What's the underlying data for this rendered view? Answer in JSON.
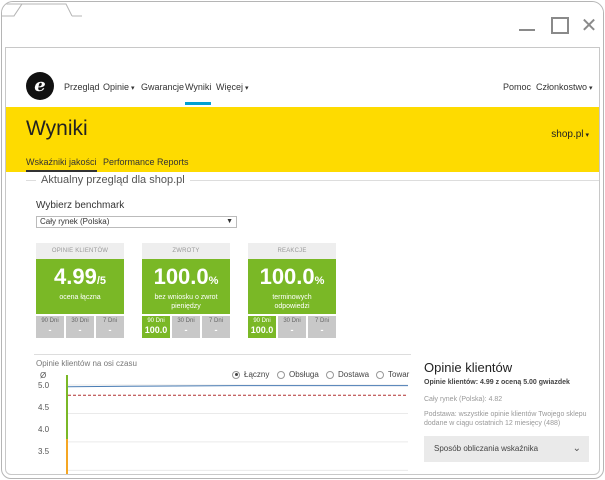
{
  "nav": {
    "items": [
      {
        "label": "Przegląd"
      },
      {
        "label": "Opinie"
      },
      {
        "label": "Gwarancje"
      },
      {
        "label": "Wyniki"
      },
      {
        "label": "Więcej"
      },
      {
        "label": "Pomoc"
      },
      {
        "label": "Członkostwo"
      }
    ]
  },
  "header": {
    "title": "Wyniki",
    "shop_selector": "shop.pl",
    "tabs": [
      {
        "label": "Wskaźniki jakości"
      },
      {
        "label": "Performance Reports"
      }
    ]
  },
  "overview": {
    "title": "Aktualny przegląd dla shop.pl",
    "benchmark_label": "Wybierz benchmark",
    "benchmark_value": "Cały rynek (Polska)"
  },
  "cards": [
    {
      "head": "OPINIE KLIENTÓW",
      "value": "4.99",
      "suffix": "/5",
      "sub": "ocena łączna",
      "periods": [
        {
          "label": "90 Dni",
          "value": "-"
        },
        {
          "label": "30 Dni",
          "value": "-"
        },
        {
          "label": "7 Dni",
          "value": "-"
        }
      ]
    },
    {
      "head": "ZWROTY",
      "value": "100.0",
      "suffix": "%",
      "sub": "bez wniosku o zwrot pieniędzy",
      "periods": [
        {
          "label": "90 Dni",
          "value": "100.0"
        },
        {
          "label": "30 Dni",
          "value": "-"
        },
        {
          "label": "7 Dni",
          "value": "-"
        }
      ]
    },
    {
      "head": "REAKCJE",
      "value": "100.0",
      "suffix": "%",
      "sub": "terminowych odpowiedzi",
      "periods": [
        {
          "label": "90 Dni",
          "value": "100.0"
        },
        {
          "label": "30 Dni",
          "value": "-"
        },
        {
          "label": "7 Dni",
          "value": "-"
        }
      ]
    }
  ],
  "chart": {
    "title": "Opinie klientów na osi czasu",
    "avg_label": "Ø",
    "legend": [
      {
        "label": "Łączny",
        "selected": true
      },
      {
        "label": "Obsługa",
        "selected": false
      },
      {
        "label": "Dostawa",
        "selected": false
      },
      {
        "label": "Towar",
        "selected": false
      }
    ],
    "yticks": [
      "5.0",
      "4.5",
      "4.0",
      "3.5"
    ]
  },
  "chart_data": {
    "type": "line",
    "title": "Opinie klientów na osi czasu",
    "ylim": [
      3.4,
      5.0
    ],
    "series": [
      {
        "name": "Łączny",
        "values": [
          4.97,
          4.98,
          4.99,
          4.99,
          4.99
        ]
      },
      {
        "values": [
          4.82,
          4.82,
          4.82,
          4.82,
          4.82
        ]
      }
    ]
  },
  "panel": {
    "title": "Opinie klientów",
    "summary": "Opinie klientów: 4.99 z oceną 5.00 gwiazdek",
    "market": "Cały rynek (Polska): 4.82",
    "note": "Podstawa: wszystkie opinie klientów Twojego sklepu dodane w ciągu ostatnich 12 miesięcy (488)",
    "accordion": "Sposób obliczania wskaźnika"
  },
  "colors": {
    "brand_yellow": "#fedb00",
    "kpi_green": "#7ab826",
    "active_blue": "#00a0d2",
    "chart_line": "#4a7db5",
    "benchmark_line": "#b03030"
  }
}
